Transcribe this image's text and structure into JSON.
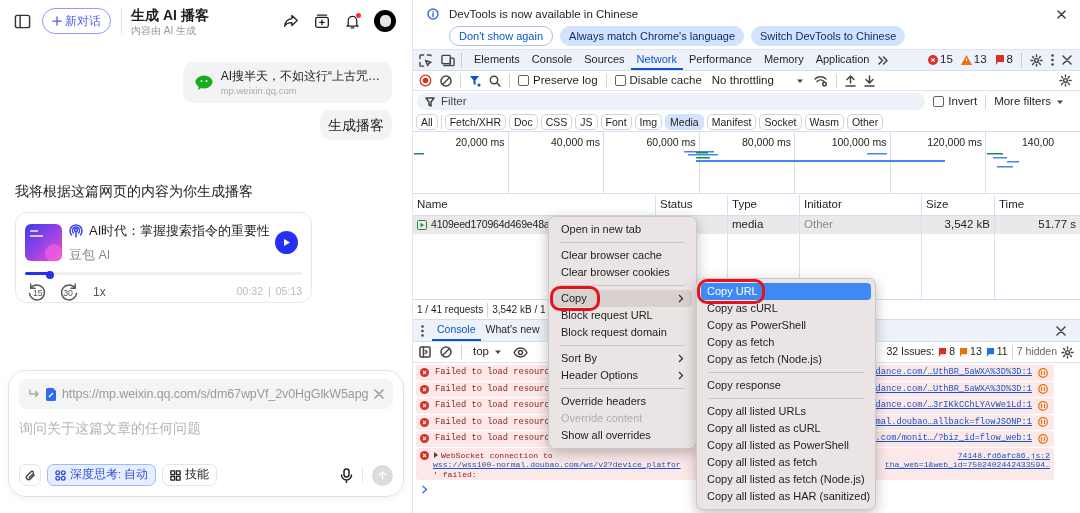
{
  "chat": {
    "header": {
      "new_chat": "新对话",
      "title": "生成 AI 播客",
      "subtitle": "内容由 AI 生成",
      "notification": true
    },
    "shared_link": {
      "title": "AI搜半天，不如这行“上古咒…",
      "domain": "mp.weixin.qq.com"
    },
    "user_message": "生成播客",
    "assistant_message": "我将根据这篇网页的内容为你生成播客",
    "podcast": {
      "title": "AI时代：掌握搜索指令的重要性",
      "author": "豆包 AI",
      "level": 0.09,
      "skip_back": "15",
      "skip_forward": "30",
      "speed": "1x",
      "elapsed": "00:32",
      "separator": "|",
      "duration": "05:13"
    },
    "composer": {
      "link": "https://mp.weixin.qq.com/s/dm67wpVf_2v0HgGlkW5apg",
      "placeholder": "询问关于这篇文章的任何问题",
      "chips": [
        {
          "kind": "thinking",
          "label": "深度思考: 自动",
          "selected": true
        },
        {
          "kind": "skills",
          "label": "技能",
          "selected": false
        }
      ],
      "send_disabled": true
    }
  },
  "devtools": {
    "infobar": {
      "message": "DevTools is now available in Chinese",
      "buttons": [
        {
          "label": "Don't show again",
          "kind": "outline"
        },
        {
          "label": "Always match Chrome's language",
          "kind": "filled"
        },
        {
          "label": "Switch DevTools to Chinese",
          "kind": "filled"
        }
      ]
    },
    "tabs": [
      {
        "label": "Elements",
        "selected": false
      },
      {
        "label": "Console",
        "selected": false
      },
      {
        "label": "Sources",
        "selected": false
      },
      {
        "label": "Network",
        "selected": true
      },
      {
        "label": "Performance",
        "selected": false
      },
      {
        "label": "Memory",
        "selected": false
      },
      {
        "label": "Application",
        "selected": false
      }
    ],
    "counts": {
      "errors": "15",
      "warnings": "13",
      "issues": "8"
    },
    "toolbar": {
      "preserve_log": false,
      "disable_cache": false,
      "preserve_label": "Preserve log",
      "cache_label": "Disable cache",
      "throttling": "No throttling"
    },
    "filter": {
      "placeholder": "Filter",
      "invert": false,
      "invert_label": "Invert",
      "more": "More filters"
    },
    "types": [
      {
        "label": "All",
        "selected": false
      },
      {
        "label": "Fetch/XHR",
        "selected": false
      },
      {
        "label": "Doc",
        "selected": false
      },
      {
        "label": "CSS",
        "selected": false
      },
      {
        "label": "JS",
        "selected": false
      },
      {
        "label": "Font",
        "selected": false
      },
      {
        "label": "Img",
        "selected": false
      },
      {
        "label": "Media",
        "selected": true
      },
      {
        "label": "Manifest",
        "selected": false
      },
      {
        "label": "Socket",
        "selected": false
      },
      {
        "label": "Wasm",
        "selected": false
      },
      {
        "label": "Other",
        "selected": false
      }
    ],
    "overview": {
      "ticks": [
        "20,000 ms",
        "40,000 ms",
        "60,000 ms",
        "80,000 ms",
        "100,000 ms",
        "120,000 ms",
        "140,00"
      ]
    },
    "table": {
      "columns": [
        "Name",
        "Status",
        "Type",
        "Initiator",
        "Size",
        "Time"
      ],
      "rows": [
        {
          "name": "4109eed170964d469e48a",
          "type": "media",
          "initiator": "Other",
          "size": "3,542 kB",
          "time": "51.77 s",
          "selected": true
        }
      ]
    },
    "summary": [
      "1 / 41 requests",
      "3,542 kB / 1"
    ],
    "drawer": {
      "tabs": [
        {
          "label": "Console",
          "selected": true
        },
        {
          "label": "What's new",
          "selected": false
        }
      ],
      "context": "top",
      "issues_label": "32 Issues:",
      "issue_counts": [
        {
          "kind": "error",
          "count": "8"
        },
        {
          "kind": "warning",
          "count": "13"
        },
        {
          "kind": "info",
          "count": "11"
        }
      ],
      "hidden": "7 hidden",
      "messages": [
        {
          "kind": "error",
          "text": "Failed to load resourc",
          "source": "dance.com/…UthBR_5aWXA%3D%3D:1"
        },
        {
          "kind": "error",
          "text": "Failed to load resourc",
          "source": "dance.com/…UthBR_5aWXA%3D%3D:1"
        },
        {
          "kind": "error",
          "text": "Failed to load resourc",
          "source": "dance.com/…3rIKkCChLYAvWe1Ld:1"
        },
        {
          "kind": "error",
          "text": "Failed to load resourc",
          "source": "mal.doubao…allback=flowJSONP:1"
        },
        {
          "kind": "error",
          "text": "Failed to load resourc",
          "source": ".com/monit…/?biz_id=flow_web:1"
        },
        {
          "kind": "websocket",
          "text": "WebSocket connection to",
          "source": "74148.fd6afc86.js:2",
          "url": "wss://wss100-normal.doubao.com/ws/v2?device_platfor",
          "url_tail": "tha_web=1&web_id=7502402442433594…",
          "tail": "' failed:"
        }
      ]
    },
    "context_menu": {
      "groups": [
        [
          {
            "label": "Open in new tab",
            "has_submenu": false,
            "highlighted": false,
            "disabled": false,
            "circled": false
          }
        ],
        [
          {
            "label": "Clear browser cache",
            "has_submenu": false,
            "highlighted": false,
            "disabled": false,
            "circled": false
          },
          {
            "label": "Clear browser cookies",
            "has_submenu": false,
            "highlighted": false,
            "disabled": false,
            "circled": false
          }
        ],
        [
          {
            "label": "Copy",
            "has_submenu": true,
            "highlighted": true,
            "disabled": false,
            "circled": true
          },
          {
            "label": "Block request URL",
            "has_submenu": false,
            "highlighted": false,
            "disabled": false,
            "circled": false
          },
          {
            "label": "Block request domain",
            "has_submenu": false,
            "highlighted": false,
            "disabled": false,
            "circled": false
          }
        ],
        [
          {
            "label": "Sort By",
            "has_submenu": true,
            "highlighted": false,
            "disabled": false,
            "circled": false
          },
          {
            "label": "Header Options",
            "has_submenu": true,
            "highlighted": false,
            "disabled": false,
            "circled": false
          }
        ],
        [
          {
            "label": "Override headers",
            "has_submenu": false,
            "highlighted": false,
            "disabled": false,
            "circled": false
          },
          {
            "label": "Override content",
            "has_submenu": false,
            "highlighted": false,
            "disabled": true,
            "circled": false
          },
          {
            "label": "Show all overrides",
            "has_submenu": false,
            "highlighted": false,
            "disabled": false,
            "circled": false
          }
        ]
      ]
    },
    "copy_menu": {
      "groups": [
        [
          {
            "label": "Copy URL",
            "highlighted": true,
            "circled": true
          },
          {
            "label": "Copy as cURL",
            "highlighted": false,
            "circled": false
          },
          {
            "label": "Copy as PowerShell",
            "highlighted": false,
            "circled": false
          },
          {
            "label": "Copy as fetch",
            "highlighted": false,
            "circled": false
          },
          {
            "label": "Copy as fetch (Node.js)",
            "highlighted": false,
            "circled": false
          }
        ],
        [
          {
            "label": "Copy response",
            "highlighted": false,
            "circled": false
          }
        ],
        [
          {
            "label": "Copy all listed URLs",
            "highlighted": false,
            "circled": false
          },
          {
            "label": "Copy all listed as cURL",
            "highlighted": false,
            "circled": false
          },
          {
            "label": "Copy all listed as PowerShell",
            "highlighted": false,
            "circled": false
          },
          {
            "label": "Copy all listed as fetch",
            "highlighted": false,
            "circled": false
          },
          {
            "label": "Copy all listed as fetch (Node.js)",
            "highlighted": false,
            "circled": false
          },
          {
            "label": "Copy all listed as HAR (sanitized)",
            "highlighted": false,
            "circled": false
          }
        ]
      ]
    }
  }
}
